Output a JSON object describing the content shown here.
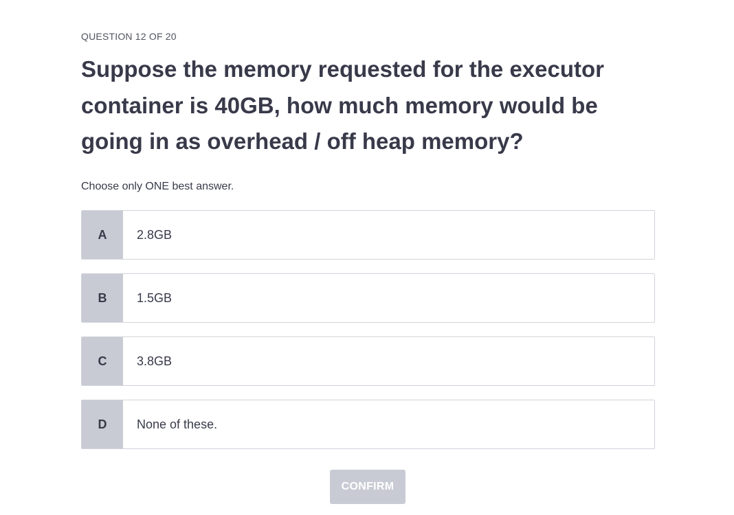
{
  "quiz": {
    "counter": "QUESTION 12 OF 20",
    "question": "Suppose the memory requested for the executor container is 40GB, how much memory would be going in as overhead / off heap memory?",
    "instruction": "Choose only ONE best answer.",
    "options": [
      {
        "letter": "A",
        "label": "2.8GB"
      },
      {
        "letter": "B",
        "label": "1.5GB"
      },
      {
        "letter": "C",
        "label": "3.8GB"
      },
      {
        "letter": "D",
        "label": "None of these."
      }
    ],
    "confirm_label": "CONFIRM"
  },
  "colors": {
    "letter_bg": "#c9cbd4",
    "text": "#383a4a",
    "button_bg_disabled": "#c9cbd4"
  }
}
